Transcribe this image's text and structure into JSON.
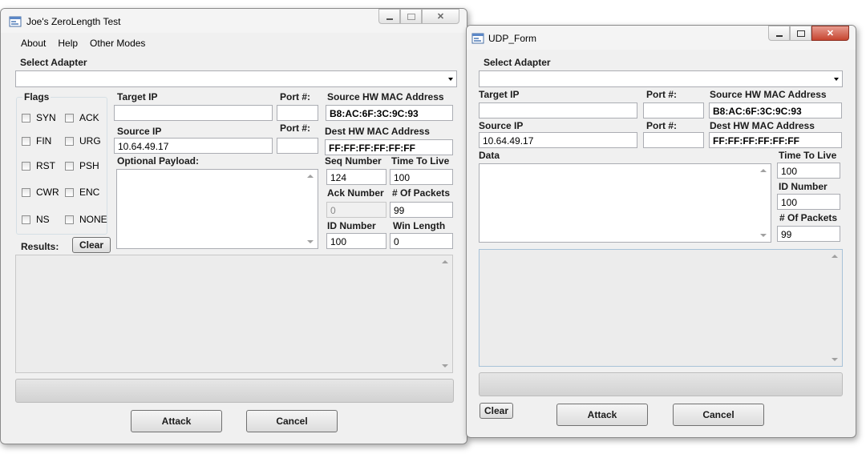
{
  "zero_window": {
    "title": "Joe's ZeroLength Test",
    "menu": [
      "About",
      "Help",
      "Other Modes"
    ],
    "select_adapter_label": "Select Adapter",
    "adapter_value": "",
    "flags_label": "Flags",
    "flags": [
      "SYN",
      "ACK",
      "FIN",
      "URG",
      "RST",
      "PSH",
      "CWR",
      "ENC",
      "NS",
      "NONE"
    ],
    "target_ip_label": "Target IP",
    "target_ip": "",
    "port1_label": "Port #:",
    "port1": "",
    "source_ip_label": "Source IP",
    "source_ip": "10.64.49.17",
    "port2_label": "Port #:",
    "port2": "",
    "payload_label": "Optional Payload:",
    "src_mac_label": "Source HW MAC Address",
    "src_mac": "B8:AC:6F:3C:9C:93",
    "dest_mac_label": "Dest HW MAC Address",
    "dest_mac": "FF:FF:FF:FF:FF:FF",
    "seq_label": "Seq Number",
    "seq": "124",
    "ttl_label": "Time To Live",
    "ttl": "100",
    "ack_label": "Ack Number",
    "ack": "0",
    "packets_label": "# Of Packets",
    "packets": "99",
    "id_label": "ID Number",
    "id": "100",
    "win_label": "Win Length",
    "win": "0",
    "results_label": "Results:",
    "clear_label": "Clear",
    "attack_label": "Attack",
    "cancel_label": "Cancel"
  },
  "udp_window": {
    "title": "UDP_Form",
    "select_adapter_label": "Select Adapter",
    "target_ip_label": "Target IP",
    "target_ip": "",
    "port1_label": "Port #:",
    "port1": "",
    "src_mac_label": "Source HW MAC Address",
    "src_mac": "B8:AC:6F:3C:9C:93",
    "source_ip_label": "Source IP",
    "source_ip": "10.64.49.17",
    "port2_label": "Port #:",
    "port2": "",
    "dest_mac_label": "Dest HW MAC Address",
    "dest_mac": "FF:FF:FF:FF:FF:FF",
    "data_label": "Data",
    "ttl_label": "Time To Live",
    "ttl": "100",
    "id_label": "ID Number",
    "id": "100",
    "packets_label": "# Of Packets",
    "packets": "99",
    "clear_label": "Clear",
    "attack_label": "Attack",
    "cancel_label": "Cancel"
  },
  "icons": {
    "app": "app-form-icon",
    "minimize": "minimize-icon",
    "maximize": "maximize-icon",
    "close": "close-icon"
  },
  "colors": {
    "window_bg": "#f0f0f0",
    "close_active": "#c64530"
  }
}
